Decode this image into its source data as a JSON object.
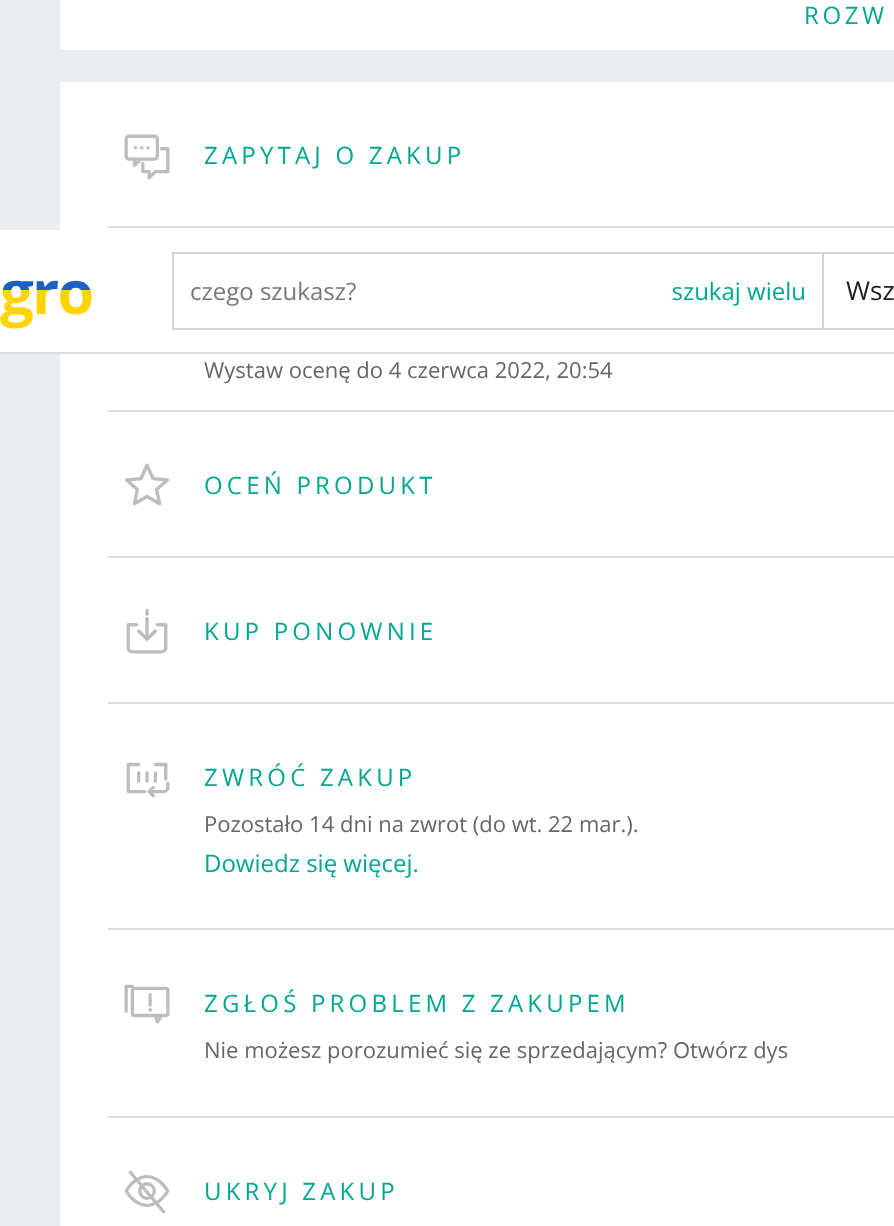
{
  "top_card": {
    "link": "ROZW"
  },
  "actions": [
    {
      "title": "ZAPYTAJ O ZAKUP"
    },
    {
      "description": "Wystaw ocenę do 4 czerwca 2022, 20:54"
    },
    {
      "title": "OCEŃ PRODUKT"
    },
    {
      "title": "KUP PONOWNIE"
    },
    {
      "title": "ZWRÓĆ ZAKUP",
      "description": "Pozostało 14 dni na zwrot (do wt. 22 mar.).",
      "link": "Dowiedz się więcej."
    },
    {
      "title": "ZGŁOŚ PROBLEM Z ZAKUPEM",
      "description": "Nie możesz porozumieć się ze sprzedającym? Otwórz dys"
    },
    {
      "title": "UKRYJ ZAKUP"
    }
  ],
  "header": {
    "logo": "gro",
    "search": {
      "placeholder": "czego szukasz?"
    },
    "multi_search": "szukaj wielu",
    "category": "Wsz"
  }
}
